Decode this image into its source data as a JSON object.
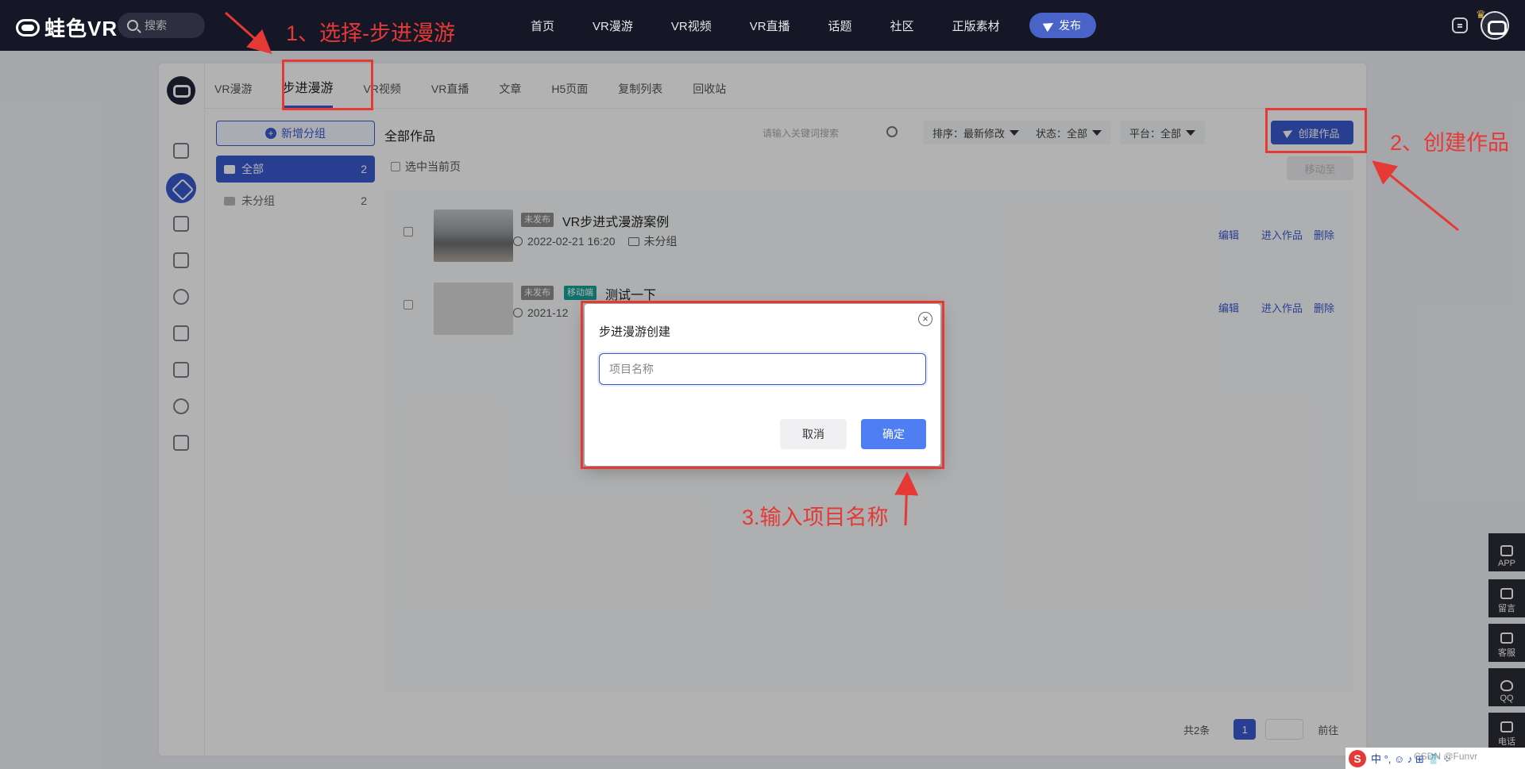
{
  "topbar": {
    "logo_text": "蛙色VR",
    "search_label": "搜索",
    "nav": [
      "首页",
      "VR漫游",
      "VR视频",
      "VR直播",
      "话题",
      "社区",
      "正版素材"
    ],
    "publish_label": "发布"
  },
  "tabs": [
    "VR漫游",
    "步进漫游",
    "VR视频",
    "VR直播",
    "文章",
    "H5页面",
    "复制列表",
    "回收站"
  ],
  "groups": {
    "new_group_label": "新增分组",
    "items": [
      {
        "label": "全部",
        "count": "2"
      },
      {
        "label": "未分组",
        "count": "2"
      }
    ]
  },
  "content": {
    "title": "全部作品",
    "search_placeholder": "请输入关键词搜索",
    "sort_label": "排序：最新修改",
    "status_label": "状态：全部",
    "platform_label": "平台：全部",
    "create_label": "创建作品",
    "select_page_label": "选中当前页",
    "move_label": "移动至"
  },
  "rows": [
    {
      "badge": "未发布",
      "title": "VR步进式漫游案例",
      "date": "2022-02-21 16:20",
      "group": "未分组",
      "actions": [
        "编辑",
        "进入作品",
        "删除"
      ]
    },
    {
      "badge": "未发布",
      "badge2": "移动端",
      "title": "测试一下",
      "date": "2021-12",
      "actions": [
        "编辑",
        "进入作品",
        "删除"
      ]
    }
  ],
  "pagination": {
    "total": "共2条",
    "page": "1",
    "goto": "前往"
  },
  "modal": {
    "title": "步进漫游创建",
    "input_placeholder": "项目名称",
    "cancel": "取消",
    "confirm": "确定"
  },
  "float_bar": [
    "APP",
    "留言",
    "客服",
    "QQ",
    "电话"
  ],
  "annotations": {
    "step1": "1、选择-步进漫游",
    "step2": "2、创建作品",
    "step3": "3.输入项目名称"
  },
  "ime": {
    "logo": "S",
    "text": "中 °, ☺ ♪ ⊞ 👕 ⁘",
    "watermark": "CSDN @Funvr"
  },
  "colors": {
    "accent": "#3a5bd0",
    "annotation": "#e53935",
    "topbar": "#161726",
    "badge_teal": "#17a39a"
  }
}
